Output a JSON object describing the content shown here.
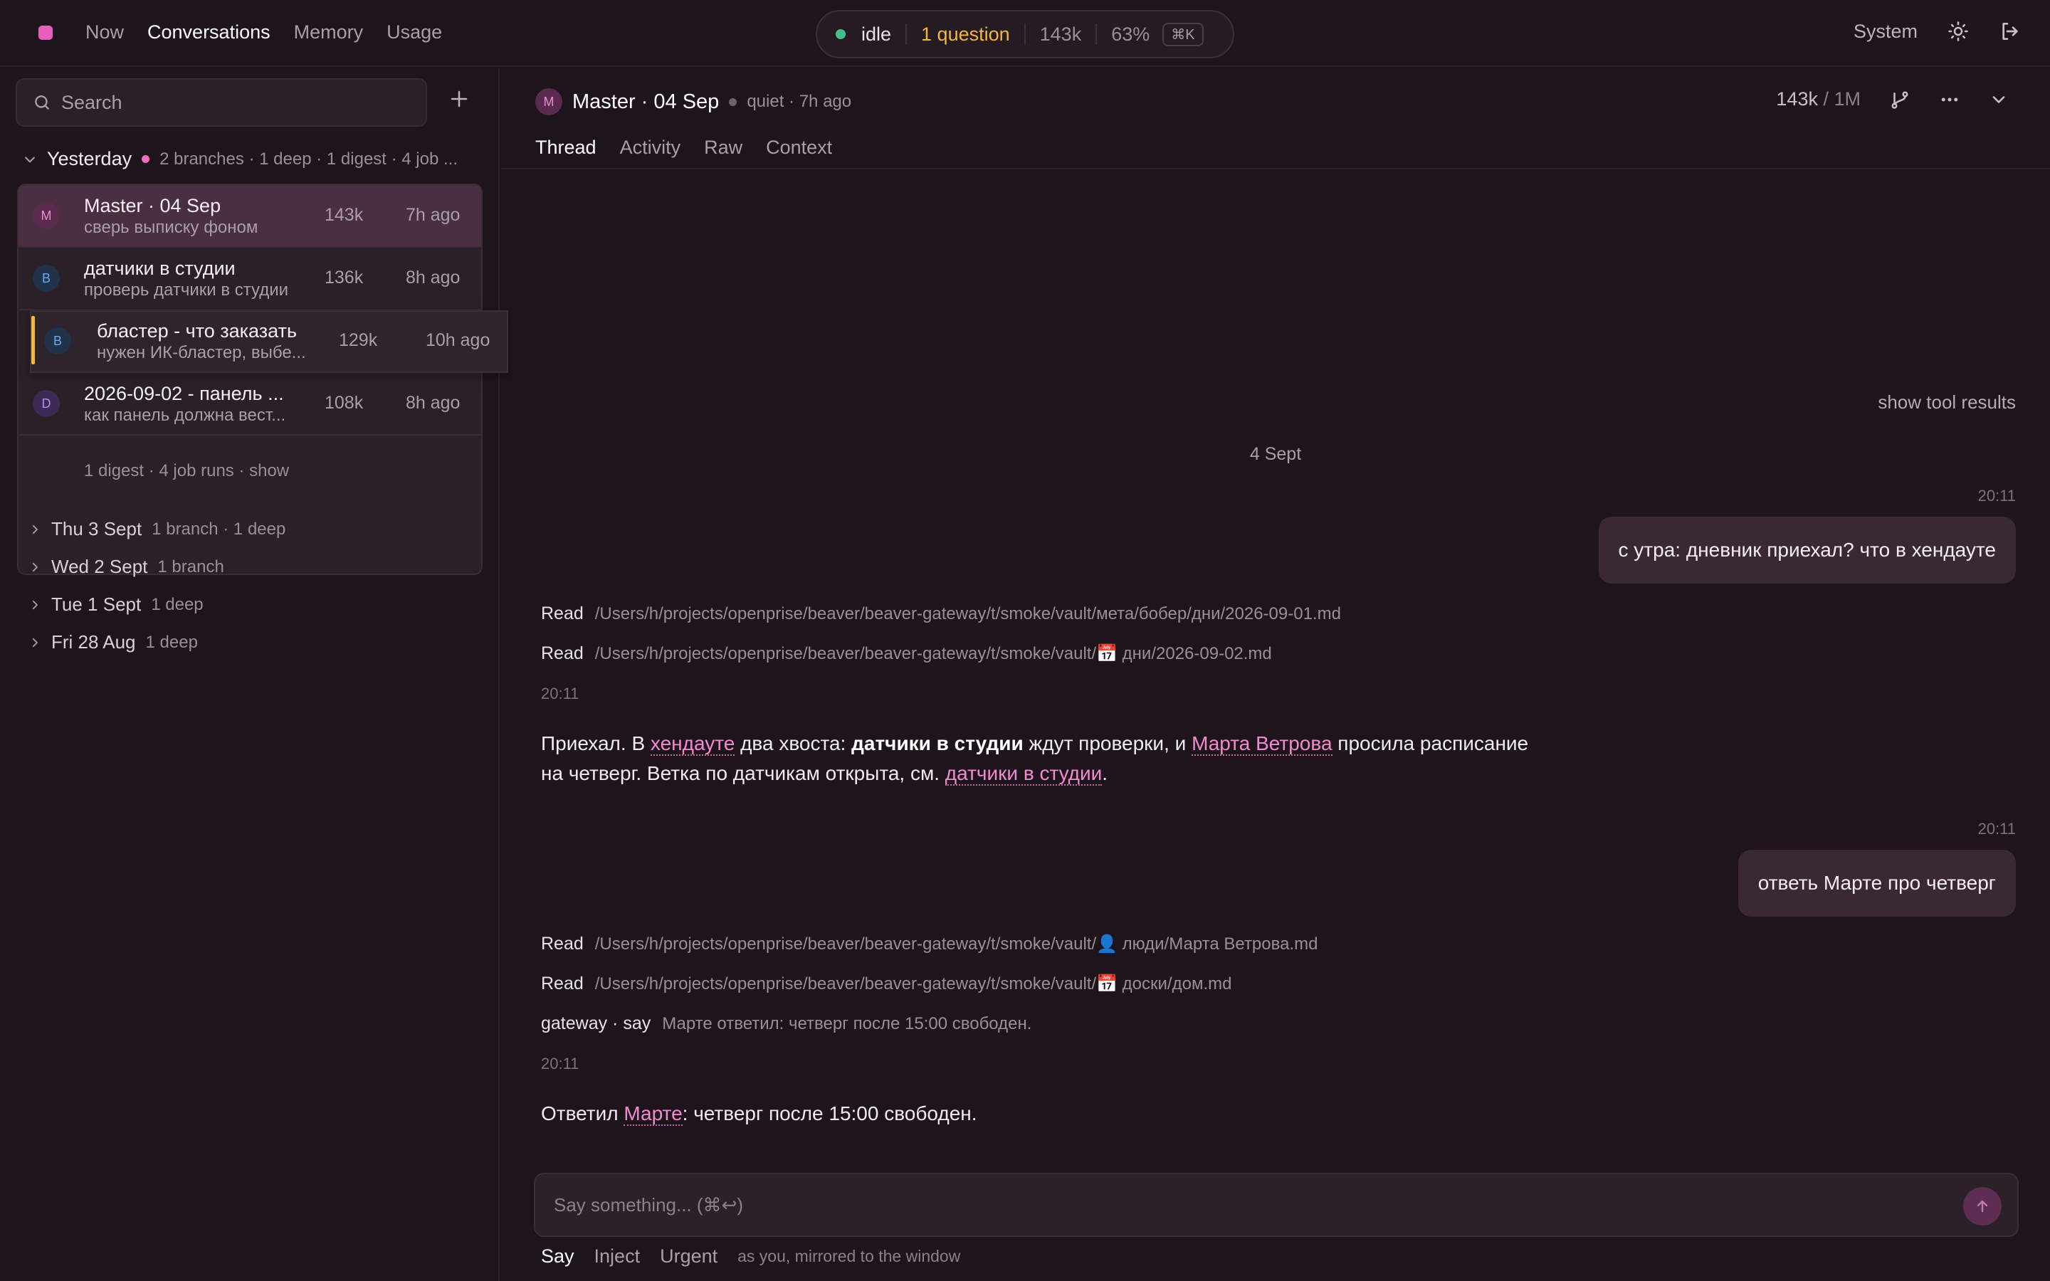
{
  "nav": {
    "items": [
      "Now",
      "Conversations",
      "Memory",
      "Usage"
    ],
    "active_index": 1
  },
  "status": {
    "state": "idle",
    "questions": "1 question",
    "tokens": "143k",
    "percent": "63%",
    "shortcut": "⌘K",
    "state_color": "#3ec28a",
    "question_color": "#f5b63c"
  },
  "top_right": {
    "theme_label": "System"
  },
  "sidebar": {
    "search_placeholder": "Search",
    "group": {
      "title": "Yesterday",
      "meta": "2 branches · 1 deep · 1 digest · 4 job ..."
    },
    "conversations": [
      {
        "avatar": "M",
        "title": "Master · 04 Sep",
        "subtitle": "сверь выписку фоном",
        "tokens": "143k",
        "ago": "7h ago"
      },
      {
        "avatar": "B",
        "title": "датчики в студии",
        "subtitle": "проверь датчики в студии",
        "tokens": "136k",
        "ago": "8h ago"
      },
      {
        "avatar": "B",
        "title": "бластер - что заказать",
        "subtitle": "нужен ИК-бластер, выбе...",
        "tokens": "129k",
        "ago": "10h ago"
      },
      {
        "avatar": "D",
        "title": "2026-09-02 - панель ...",
        "subtitle": "как панель должна вест...",
        "tokens": "108k",
        "ago": "8h ago"
      }
    ],
    "digest": "1 digest · 4 job runs · show",
    "days": [
      {
        "date": "Thu 3 Sept",
        "meta": "1 branch · 1 deep"
      },
      {
        "date": "Wed 2 Sept",
        "meta": "1 branch"
      },
      {
        "date": "Tue 1 Sept",
        "meta": "1 deep"
      },
      {
        "date": "Fri 28 Aug",
        "meta": "1 deep"
      }
    ]
  },
  "main": {
    "avatar": "M",
    "title": "Master · 04 Sep",
    "status": "quiet · 7h ago",
    "context_used": "143k",
    "context_total": "/ 1M",
    "tabs": [
      "Thread",
      "Activity",
      "Raw",
      "Context"
    ],
    "active_tab": 0,
    "show_tool_results": "show tool results",
    "date_separator": "4 Sept",
    "messages": {
      "m1_time": "20:11",
      "m1_text": "с утра: дневник приехал? что в хендауте",
      "read1_verb": "Read",
      "read1_path": "/Users/h/projects/openprise/beaver/beaver-gateway/t/smoke/vault/мета/бобер/дни/2026-09-01.md",
      "read2_verb": "Read",
      "read2_path": "/Users/h/projects/openprise/beaver/beaver-gateway/t/smoke/vault/📅 дни/2026-09-02.md",
      "r1_time": "20:11",
      "r1_parts": [
        "Приехал. В ",
        "хендауте",
        " два хвоста: ",
        "датчики в студии",
        " ждут проверки, и ",
        "Марта Ветрова",
        " просила расписание на четверг. Ветка по датчикам открыта, см. ",
        "датчики в студии",
        "."
      ],
      "m2_time": "20:11",
      "m2_text": "ответь Марте про четверг",
      "read3_verb": "Read",
      "read3_path": "/Users/h/projects/openprise/beaver/beaver-gateway/t/smoke/vault/👤 люди/Марта Ветрова.md",
      "read4_verb": "Read",
      "read4_path": "/Users/h/projects/openprise/beaver/beaver-gateway/t/smoke/vault/📅 доски/дом.md",
      "say_verb": "gateway · say",
      "say_text": "Марте ответил: четверг после 15:00 свободен.",
      "r2_time": "20:11",
      "r2_parts": [
        "Ответил ",
        "Марте",
        ": четверг после 15:00 свободен."
      ]
    },
    "composer_placeholder": "Say something... (⌘↩)",
    "modes": [
      "Say",
      "Inject",
      "Urgent"
    ],
    "active_mode": 0,
    "mode_hint": "as you, mirrored to the window"
  }
}
